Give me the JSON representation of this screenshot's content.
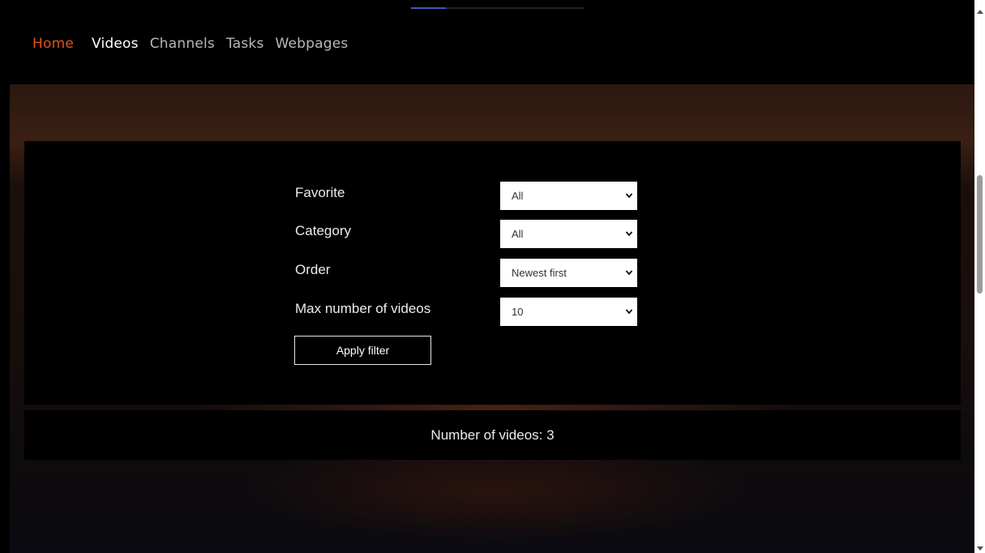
{
  "nav": {
    "home": "Home",
    "items": [
      "Videos",
      "Channels",
      "Tasks",
      "Webpages"
    ],
    "active": "Videos"
  },
  "filters": [
    {
      "label": "Favorite",
      "value": "All"
    },
    {
      "label": "Category",
      "value": "All"
    },
    {
      "label": "Order",
      "value": "Newest first"
    },
    {
      "label": "Max number of videos",
      "value": "10"
    }
  ],
  "apply_label": "Apply filter",
  "count_text": "Number of videos: 3",
  "colors": {
    "accent": "#e0531c",
    "nav_text": "#b8b8b8",
    "background": "#000000"
  }
}
